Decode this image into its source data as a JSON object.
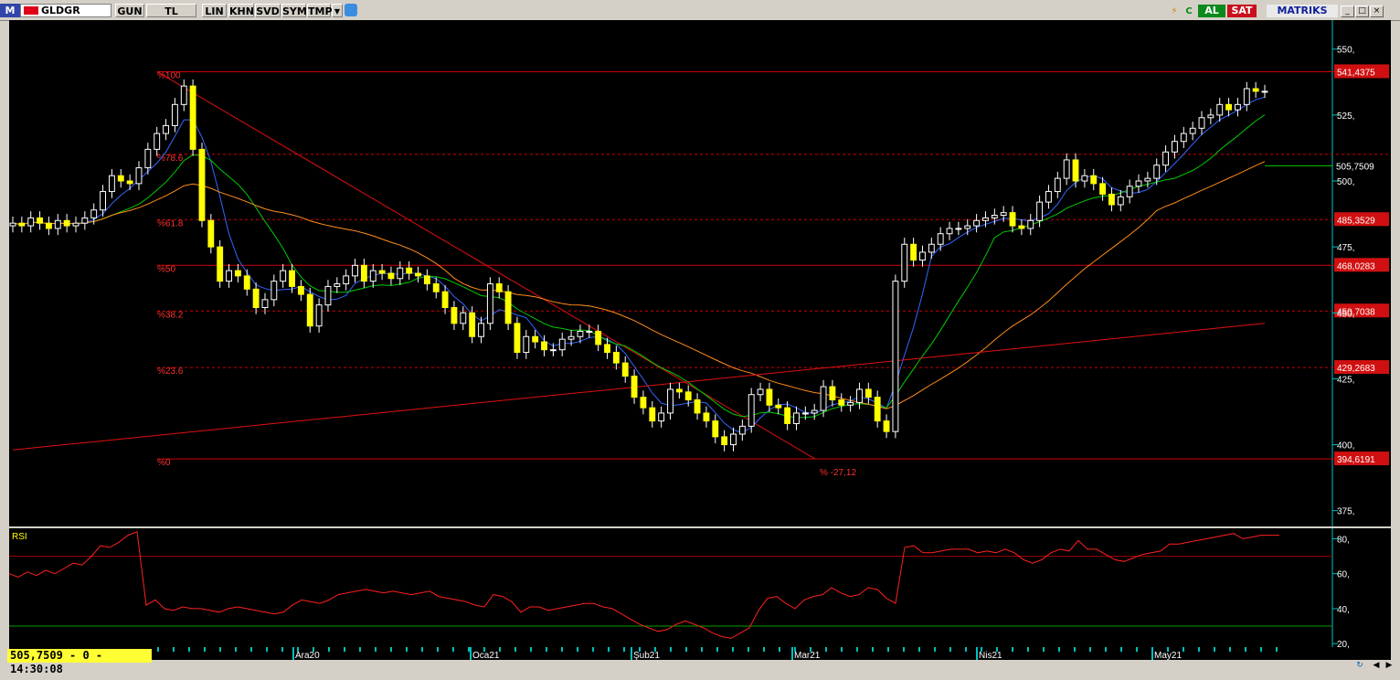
{
  "toolbar": {
    "logo": "M",
    "symbol": "GLDGR",
    "buttons": [
      "GUN",
      "TL",
      "LIN",
      "KHN",
      "SVD",
      "SYM",
      "TMP"
    ],
    "al_label": "AL",
    "sat_label": "SAT",
    "brand": "MATRIKS",
    "window_buttons": [
      "_",
      "□",
      "×"
    ]
  },
  "status": {
    "quote": "505,7509 - 0 - 14:30:08"
  },
  "colors": {
    "background": "#000000",
    "candle_up": "#ffff00",
    "ma_short": "#3366ff",
    "ma_mid": "#00cc00",
    "ma_long": "#ff8c1a",
    "ma_very_long": "#e01010",
    "fib": "#cc0000",
    "axis_text": "#ffffff"
  },
  "chart_data": [
    {
      "type": "candlestick",
      "symbol": "GLDGR",
      "y_ticks": [
        "550,",
        "525,",
        "500,",
        "475,",
        "450,",
        "425,",
        "400,",
        "375,"
      ],
      "y_tick_values": [
        550,
        525,
        500,
        475,
        450,
        425,
        400,
        375
      ],
      "ylim": [
        369,
        561
      ],
      "x_labels": [
        "Ara20",
        "Oca21",
        "Şub21",
        "Mar21",
        "Nis21",
        "May21"
      ],
      "last_price_label": "505,7509",
      "last_price": 505.75,
      "fibonacci": {
        "levels": [
          {
            "label": "%100",
            "price_label": "541,4375",
            "price": 541.44
          },
          {
            "label": "%78.6",
            "price_label": "",
            "price": 510.1
          },
          {
            "label": "%61.8",
            "price_label": "485,3529",
            "price": 485.35
          },
          {
            "label": "%50",
            "price_label": "468,0283",
            "price": 468.03
          },
          {
            "label": "%38.2",
            "price_label": "450,7038",
            "price": 450.7
          },
          {
            "label": "%23.6",
            "price_label": "429,2683",
            "price": 429.27
          },
          {
            "label": "%0",
            "price_label": "394,6191",
            "price": 394.62
          }
        ],
        "trend_label": "% -27,12"
      },
      "closes": [
        484,
        483,
        486,
        484,
        482,
        485,
        483,
        484,
        486,
        489,
        496,
        502,
        500,
        499,
        505,
        512,
        518,
        521,
        529,
        536,
        512,
        485,
        475,
        462,
        466,
        464,
        459,
        452,
        455,
        462,
        466,
        460,
        457,
        445,
        453,
        460,
        461,
        464,
        468,
        462,
        466,
        465,
        463,
        467,
        465,
        464,
        461,
        458,
        452,
        446,
        450,
        441,
        446,
        461,
        458,
        446,
        435,
        441,
        439,
        436,
        436,
        440,
        441,
        443,
        443,
        438,
        435,
        431,
        426,
        418,
        414,
        409,
        412,
        421,
        420,
        417,
        412,
        409,
        403,
        400,
        404,
        407,
        419,
        421,
        415,
        414,
        408,
        412,
        412,
        413,
        422,
        417,
        415,
        416,
        421,
        418,
        409,
        405,
        462,
        476,
        470,
        473,
        476,
        480,
        482,
        482,
        483,
        485,
        486,
        487,
        488,
        483,
        482,
        485,
        492,
        496,
        501,
        508,
        500,
        502,
        499,
        495,
        491,
        494,
        498,
        500,
        501,
        506,
        511,
        515,
        518,
        520,
        524,
        525,
        529,
        527,
        529,
        535,
        534,
        534
      ]
    },
    {
      "type": "line",
      "title": "RSI",
      "y_ticks": [
        "80,",
        "60,",
        "40,",
        "20,"
      ],
      "y_tick_values": [
        80,
        60,
        40,
        20
      ],
      "ylim": [
        18,
        86
      ],
      "reference_lines": [
        70,
        30
      ],
      "values": [
        60,
        58,
        61,
        59,
        62,
        60,
        63,
        66,
        65,
        70,
        76,
        75,
        78,
        82,
        84,
        42,
        45,
        40,
        39,
        41,
        40,
        40,
        39,
        38,
        40,
        41,
        40,
        39,
        38,
        37,
        38,
        42,
        45,
        44,
        43,
        45,
        48,
        49,
        50,
        51,
        50,
        49,
        50,
        49,
        48,
        49,
        50,
        47,
        46,
        45,
        44,
        42,
        41,
        48,
        47,
        44,
        38,
        41,
        41,
        39,
        40,
        41,
        42,
        43,
        43,
        41,
        40,
        37,
        34,
        31,
        29,
        27,
        28,
        31,
        33,
        31,
        29,
        26,
        24,
        23,
        26,
        29,
        39,
        46,
        47,
        43,
        40,
        45,
        47,
        48,
        52,
        49,
        47,
        48,
        52,
        51,
        46,
        43,
        75,
        76,
        72,
        72,
        73,
        74,
        74,
        74,
        72,
        73,
        72,
        74,
        72,
        68,
        66,
        68,
        72,
        74,
        73,
        79,
        74,
        74,
        71,
        68,
        67,
        69,
        71,
        72,
        73,
        77,
        77,
        78,
        79,
        80,
        81,
        82,
        83,
        80,
        81,
        82,
        82,
        82
      ]
    }
  ]
}
